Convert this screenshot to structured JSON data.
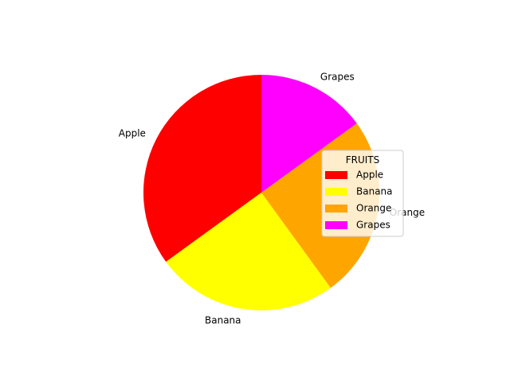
{
  "chart_data": {
    "type": "pie",
    "categories": [
      "Apple",
      "Banana",
      "Orange",
      "Grapes"
    ],
    "values": [
      35,
      25,
      25,
      15
    ],
    "colors": [
      "#ff0000",
      "#ffff00",
      "#ffa500",
      "#ff00ff"
    ],
    "start_angle": 90,
    "direction": "counterclockwise",
    "title": "",
    "legend": {
      "title": "FRUITS",
      "placement": "center-right",
      "entries": [
        "Apple",
        "Banana",
        "Orange",
        "Grapes"
      ]
    }
  }
}
